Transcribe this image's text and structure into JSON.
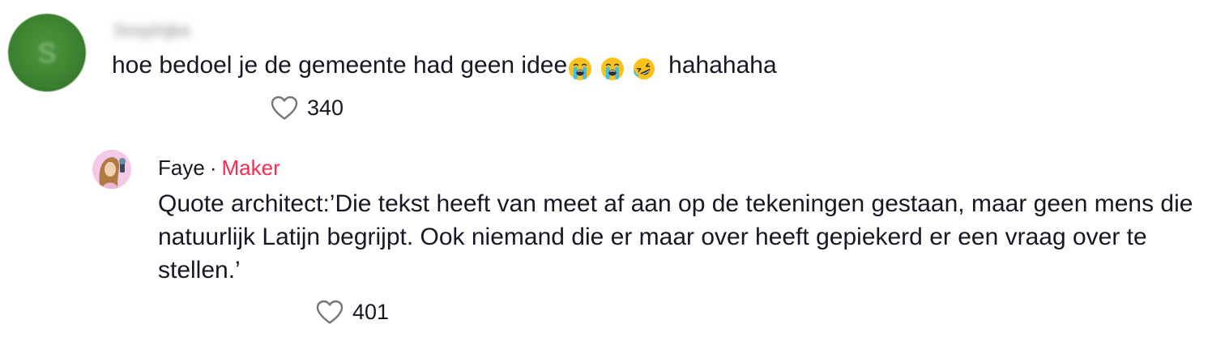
{
  "comment": {
    "username": "Sosphijke",
    "avatar_initial": "S",
    "text": "hoe bedoel je de gemeente had geen idee",
    "emojis": [
      "loudly-crying-face",
      "loudly-crying-face",
      "rolling-on-the-floor-laughing"
    ],
    "text_after_emojis": "hahahaha",
    "like_count": "340",
    "heart_icon": "heart-outline-icon"
  },
  "reply": {
    "author": "Faye",
    "separator": "·",
    "badge": "Maker",
    "badge_color": "#fe2c55",
    "text": "Quote architect:’Die tekst heeft van meet af aan op de tekeningen gestaan, maar geen mens die natuurlijk Latijn begrijpt. Ook niemand die er maar over heeft gepiekerd er een vraag over te stellen.’",
    "like_count": "401",
    "heart_icon": "heart-outline-icon"
  }
}
